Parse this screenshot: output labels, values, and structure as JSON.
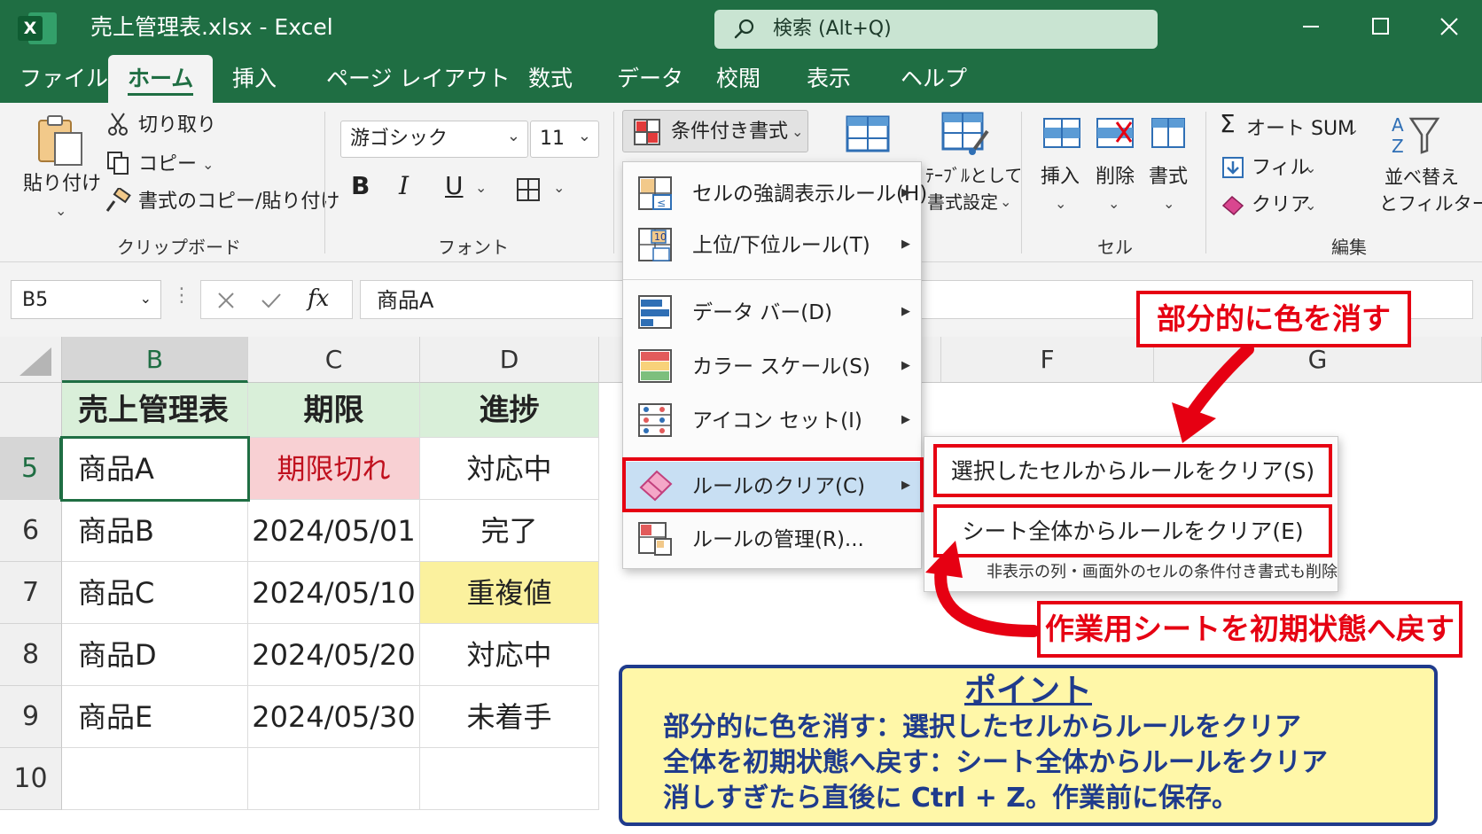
{
  "titlebar": {
    "app_letter": "X",
    "document_title": "売上管理表.xlsx  -  Excel",
    "search_placeholder": "検索 (Alt+Q)",
    "search_icon": "search-icon",
    "window_controls": [
      "minimize-icon",
      "maximize-icon",
      "close-icon"
    ]
  },
  "tabs": [
    {
      "label": "ファイル",
      "active": false
    },
    {
      "label": "ホーム",
      "active": true
    },
    {
      "label": "挿入",
      "active": false
    },
    {
      "label": "ページ レイアウト",
      "active": false
    },
    {
      "label": "数式",
      "active": false
    },
    {
      "label": "データ",
      "active": false
    },
    {
      "label": "校閲",
      "active": false
    },
    {
      "label": "表示",
      "active": false
    },
    {
      "label": "ヘルプ",
      "active": false
    }
  ],
  "ribbon": {
    "clipboard": {
      "paste": "貼り付け",
      "cut": "切り取り",
      "copy": "コピー",
      "format_painter": "書式のコピー/貼り付け",
      "group_label": "クリップボード"
    },
    "font": {
      "font_name": "游ゴシック",
      "font_size": "11",
      "bold": "B",
      "italic": "I",
      "underline": "U",
      "group_label": "フォント"
    },
    "styles": {
      "conditional_formatting": "条件付き書式",
      "format_as_table_line1": "ﾃｰﾌﾞﾙとして",
      "format_as_table_line2": "書式設定"
    },
    "cells": {
      "insert": "挿入",
      "delete": "削除",
      "format": "書式",
      "group_label": "セル"
    },
    "editing": {
      "autosum": "オート SUM",
      "fill": "フィル",
      "clear": "クリア",
      "sort_line1": "並べ替え",
      "sort_line2": "とフィルター",
      "group_label": "編集"
    }
  },
  "formula_bar": {
    "name_box": "B5",
    "fx": "fx",
    "content": "商品A"
  },
  "sheet": {
    "columns": [
      "B",
      "C",
      "D",
      "",
      "F",
      "G"
    ],
    "selected_column": "B",
    "rows": [
      "",
      "5",
      "6",
      "7",
      "8",
      "9",
      "10"
    ],
    "selected_row": "5",
    "header": [
      "売上管理表",
      "期限",
      "進捗"
    ],
    "data": [
      [
        "商品A",
        "期限切れ",
        "対応中"
      ],
      [
        "商品B",
        "2024/05/01",
        "完了"
      ],
      [
        "商品C",
        "2024/05/10",
        "重複値"
      ],
      [
        "商品D",
        "2024/05/20",
        "対応中"
      ],
      [
        "商品E",
        "2024/05/30",
        "未着手"
      ]
    ],
    "colors": {
      "header_fill": "#d9efd9",
      "expired_fill": "#f8d0d3",
      "expired_text": "#c0101e",
      "duplicate_fill": "#fbf19e"
    }
  },
  "cf_menu": {
    "items": [
      {
        "label": "セルの強調表示ルール(H)",
        "icon": "highlight-rules-icon"
      },
      {
        "label": "上位/下位ルール(T)",
        "icon": "top-bottom-rules-icon"
      },
      {
        "label": "データ バー(D)",
        "icon": "data-bars-icon"
      },
      {
        "label": "カラー スケール(S)",
        "icon": "color-scales-icon"
      },
      {
        "label": "アイコン セット(I)",
        "icon": "icon-sets-icon"
      },
      {
        "label": "ルールのクリア(C)",
        "icon": "eraser-icon"
      },
      {
        "label": "ルールの管理(R)...",
        "icon": "manage-rules-icon"
      }
    ]
  },
  "submenu": {
    "clear_selected": "選択したセルからルールをクリア(S)",
    "clear_sheet": "シート全体からルールをクリア(E)",
    "note": "非表示の列・画面外のセルの条件付き書式も削除"
  },
  "callouts": {
    "partial": "部分的に色を消す",
    "sheet": "作業用シートを初期状態へ戻す"
  },
  "point": {
    "title": "ポイント",
    "lines": [
      "部分的に色を消す：選択したセルからルールをクリア",
      "全体を初期状態へ戻す：シート全体からルールをクリア",
      "消しすぎたら直後に Ctrl + Z。作業前に保存。"
    ]
  },
  "accent_colors": {
    "excel_green": "#1f6e43",
    "highlight_red": "#e60012",
    "point_blue": "#1f3b8c",
    "point_yellow": "#fff7a8"
  }
}
